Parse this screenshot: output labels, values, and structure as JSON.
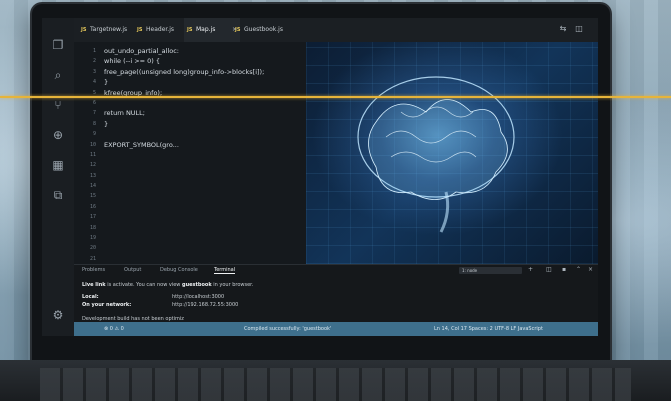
{
  "tabs": [
    {
      "label": "Targetnew.js",
      "badge": "JS",
      "active": false
    },
    {
      "label": "Header.js",
      "badge": "JS",
      "active": false
    },
    {
      "label": "Map.js",
      "badge": "JS",
      "active": true
    },
    {
      "label": "Guestbook.js",
      "badge": "JS",
      "active": false
    }
  ],
  "editor": {
    "line_numbers": [
      "1",
      "2",
      "3",
      "4",
      "5",
      "6",
      "7",
      "8",
      "9",
      "10",
      "11",
      "12",
      "13",
      "14",
      "15",
      "16",
      "17",
      "18",
      "19",
      "20",
      "21"
    ],
    "code_lines": [
      "out_undo_partial_alloc:",
      "  while (--i >= 0) {",
      "    free_page((unsigned long)group_info->blocks[i]);",
      "  }",
      "  kfree(group_info);",
      "",
      "  return NULL;",
      "}",
      "",
      "EXPORT_SYMBOL(gro..."
    ]
  },
  "panel": {
    "tabs": [
      "Problems",
      "Output",
      "Debug Console",
      "Terminal"
    ],
    "active_tab": "Terminal",
    "select_value": "1: node",
    "terminal": {
      "line1_a": "Live link",
      "line1_b": " is activate. You can now view ",
      "line1_c": "guestbook",
      "line1_d": " in your browser.",
      "local_label": "Local:",
      "local_value": "http://localhost:3000",
      "network_label": "On your network:",
      "network_value": "http://192.168.72.55:3000",
      "footer": "Development build has not been optimiz"
    }
  },
  "status": {
    "left": "⊗ 0 ⚠ 0",
    "center": "Compiled successfully: 'guestbook'",
    "right": "Ln 14, Col 17   Spaces: 2   UTF-8   LF   JavaScript"
  },
  "colors": {
    "accent_line": "#e6b43a",
    "status_bar": "#3e6f8c"
  }
}
